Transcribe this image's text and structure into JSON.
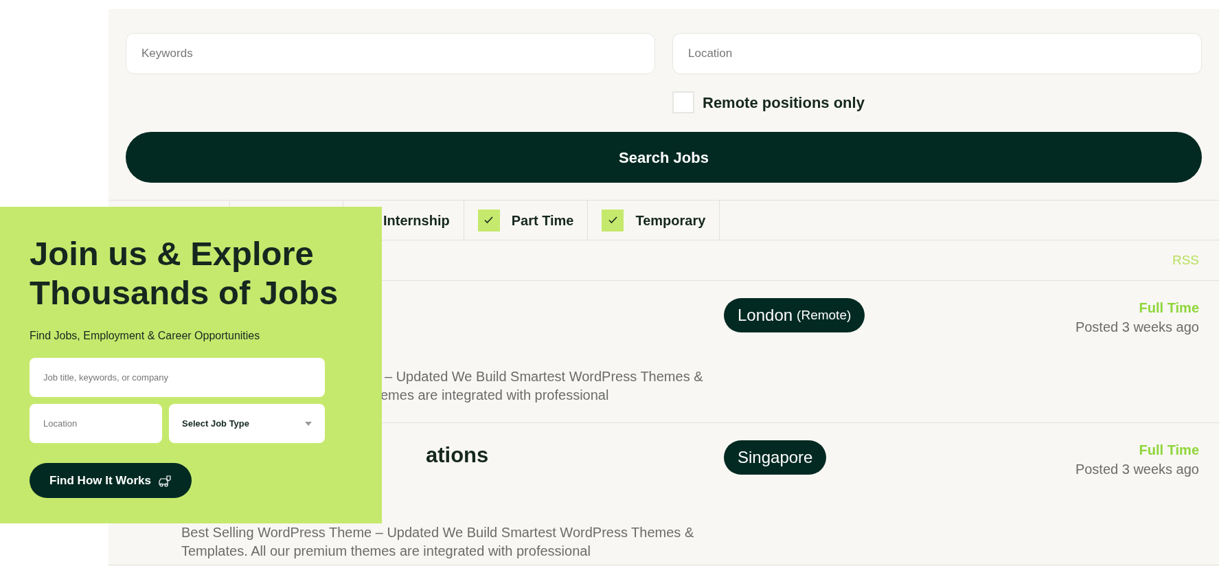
{
  "search_form": {
    "keywords": {
      "placeholder": "Keywords"
    },
    "location": {
      "placeholder": "Location"
    },
    "remote_only": {
      "label": "Remote positions only",
      "checked": false
    },
    "button": "Search Jobs"
  },
  "job_type_filters": [
    {
      "label": "Internship"
    },
    {
      "label": "Part Time",
      "checked": true
    },
    {
      "label": "Temporary",
      "checked": true
    }
  ],
  "rss": "RSS",
  "jobs": [
    {
      "description_lines": [
        "– Updated We Build Smartest WordPress Themes &",
        "emes are integrated with professional"
      ],
      "location": "London",
      "location_note": "(Remote)",
      "job_type": "Full Time",
      "posted": "Posted 3 weeks ago"
    },
    {
      "title": "ations",
      "description_lines": [
        "Best Selling WordPress Theme – Updated We Build Smartest WordPress Themes &",
        "Templates. All our premium themes are integrated with professional"
      ],
      "location": "Singapore",
      "job_type": "Full Time",
      "posted": "Posted 3 weeks ago"
    }
  ],
  "hero": {
    "heading_lines": [
      "Join us & Explore",
      "Thousands of Jobs"
    ],
    "subtitle": "Find Jobs, Employment & Career Opportunities",
    "keyword_field": {
      "placeholder": "Job title, keywords, or company"
    },
    "location_field": {
      "placeholder": "Location"
    },
    "job_type_select": {
      "value": "Select Job Type"
    },
    "button": "Find How It Works"
  }
}
